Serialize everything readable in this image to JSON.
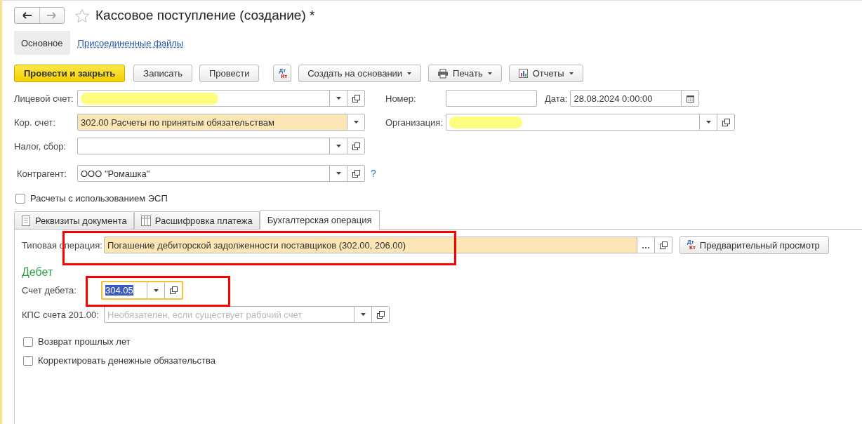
{
  "header": {
    "title": "Кассовое поступление (создание) *",
    "favorite": false
  },
  "sections": [
    {
      "label": "Основное",
      "selected": true
    },
    {
      "label": "Присоединенные файлы",
      "selected": false
    }
  ],
  "toolbar": [
    {
      "kind": "primary",
      "label": "Провести и закрыть"
    },
    {
      "kind": "plain",
      "label": "Записать"
    },
    {
      "kind": "plain",
      "label": "Провести"
    },
    {
      "kind": "dtkt",
      "icon_top": "Дт",
      "icon_bottom": "Кт"
    },
    {
      "kind": "menu",
      "label": "Создать на основании"
    },
    {
      "kind": "print",
      "label": "Печать"
    },
    {
      "kind": "reports",
      "label": "Отчеты"
    }
  ],
  "left_fields": [
    {
      "label": "Лицевой счет:",
      "redacted": true,
      "highlighted": false
    },
    {
      "label": "Кор. счет:",
      "value": "302.00 Расчеты по принятым обязательствам",
      "redacted": false,
      "highlighted": true
    },
    {
      "label": "Налог, сбор:",
      "redacted": false,
      "highlighted": false
    },
    {
      "label": "Контрагент:",
      "value": "ООО \"Ромашка\"",
      "redacted": false,
      "highlighted": false,
      "help": "?"
    }
  ],
  "right_fields": [
    {
      "label": "Номер:",
      "redacted": false,
      "highlighted": false
    },
    {
      "label": "Дата:",
      "value": "28.08.2024  0:00:00",
      "redacted": false,
      "highlighted": false
    },
    {
      "label": "Организация:",
      "redacted": true,
      "highlighted": false
    }
  ],
  "esp_checkbox": {
    "label": "Расчеты с использованием ЭСП",
    "checked": false
  },
  "doc_tabs": [
    {
      "label": "Реквизиты документа",
      "selected": false
    },
    {
      "label": "Расшифровка платежа",
      "selected": false
    },
    {
      "label": "Бухгалтерская операция",
      "selected": true
    }
  ],
  "operation": {
    "label": "Типовая операция:",
    "value": "Погашение дебиторской задолженности поставщиков (302.00, 206.00)",
    "highlighted": true
  },
  "preview_button": {
    "label": "Предварительный просмотр",
    "icon_top": "Дт",
    "icon_bottom": "Кт"
  },
  "debit": {
    "heading": "Дебет",
    "fields": [
      {
        "label": "Счет дебета:",
        "value": "304.05",
        "focused": true
      },
      {
        "label": "КПС счета 201.00:",
        "placeholder": "Необязателен, если существует рабочий счет",
        "focused": false
      }
    ]
  },
  "options": [
    {
      "label": "Возврат прошлых лет",
      "checked": false
    },
    {
      "label": "Корректировать денежные обязательства",
      "checked": false
    }
  ]
}
